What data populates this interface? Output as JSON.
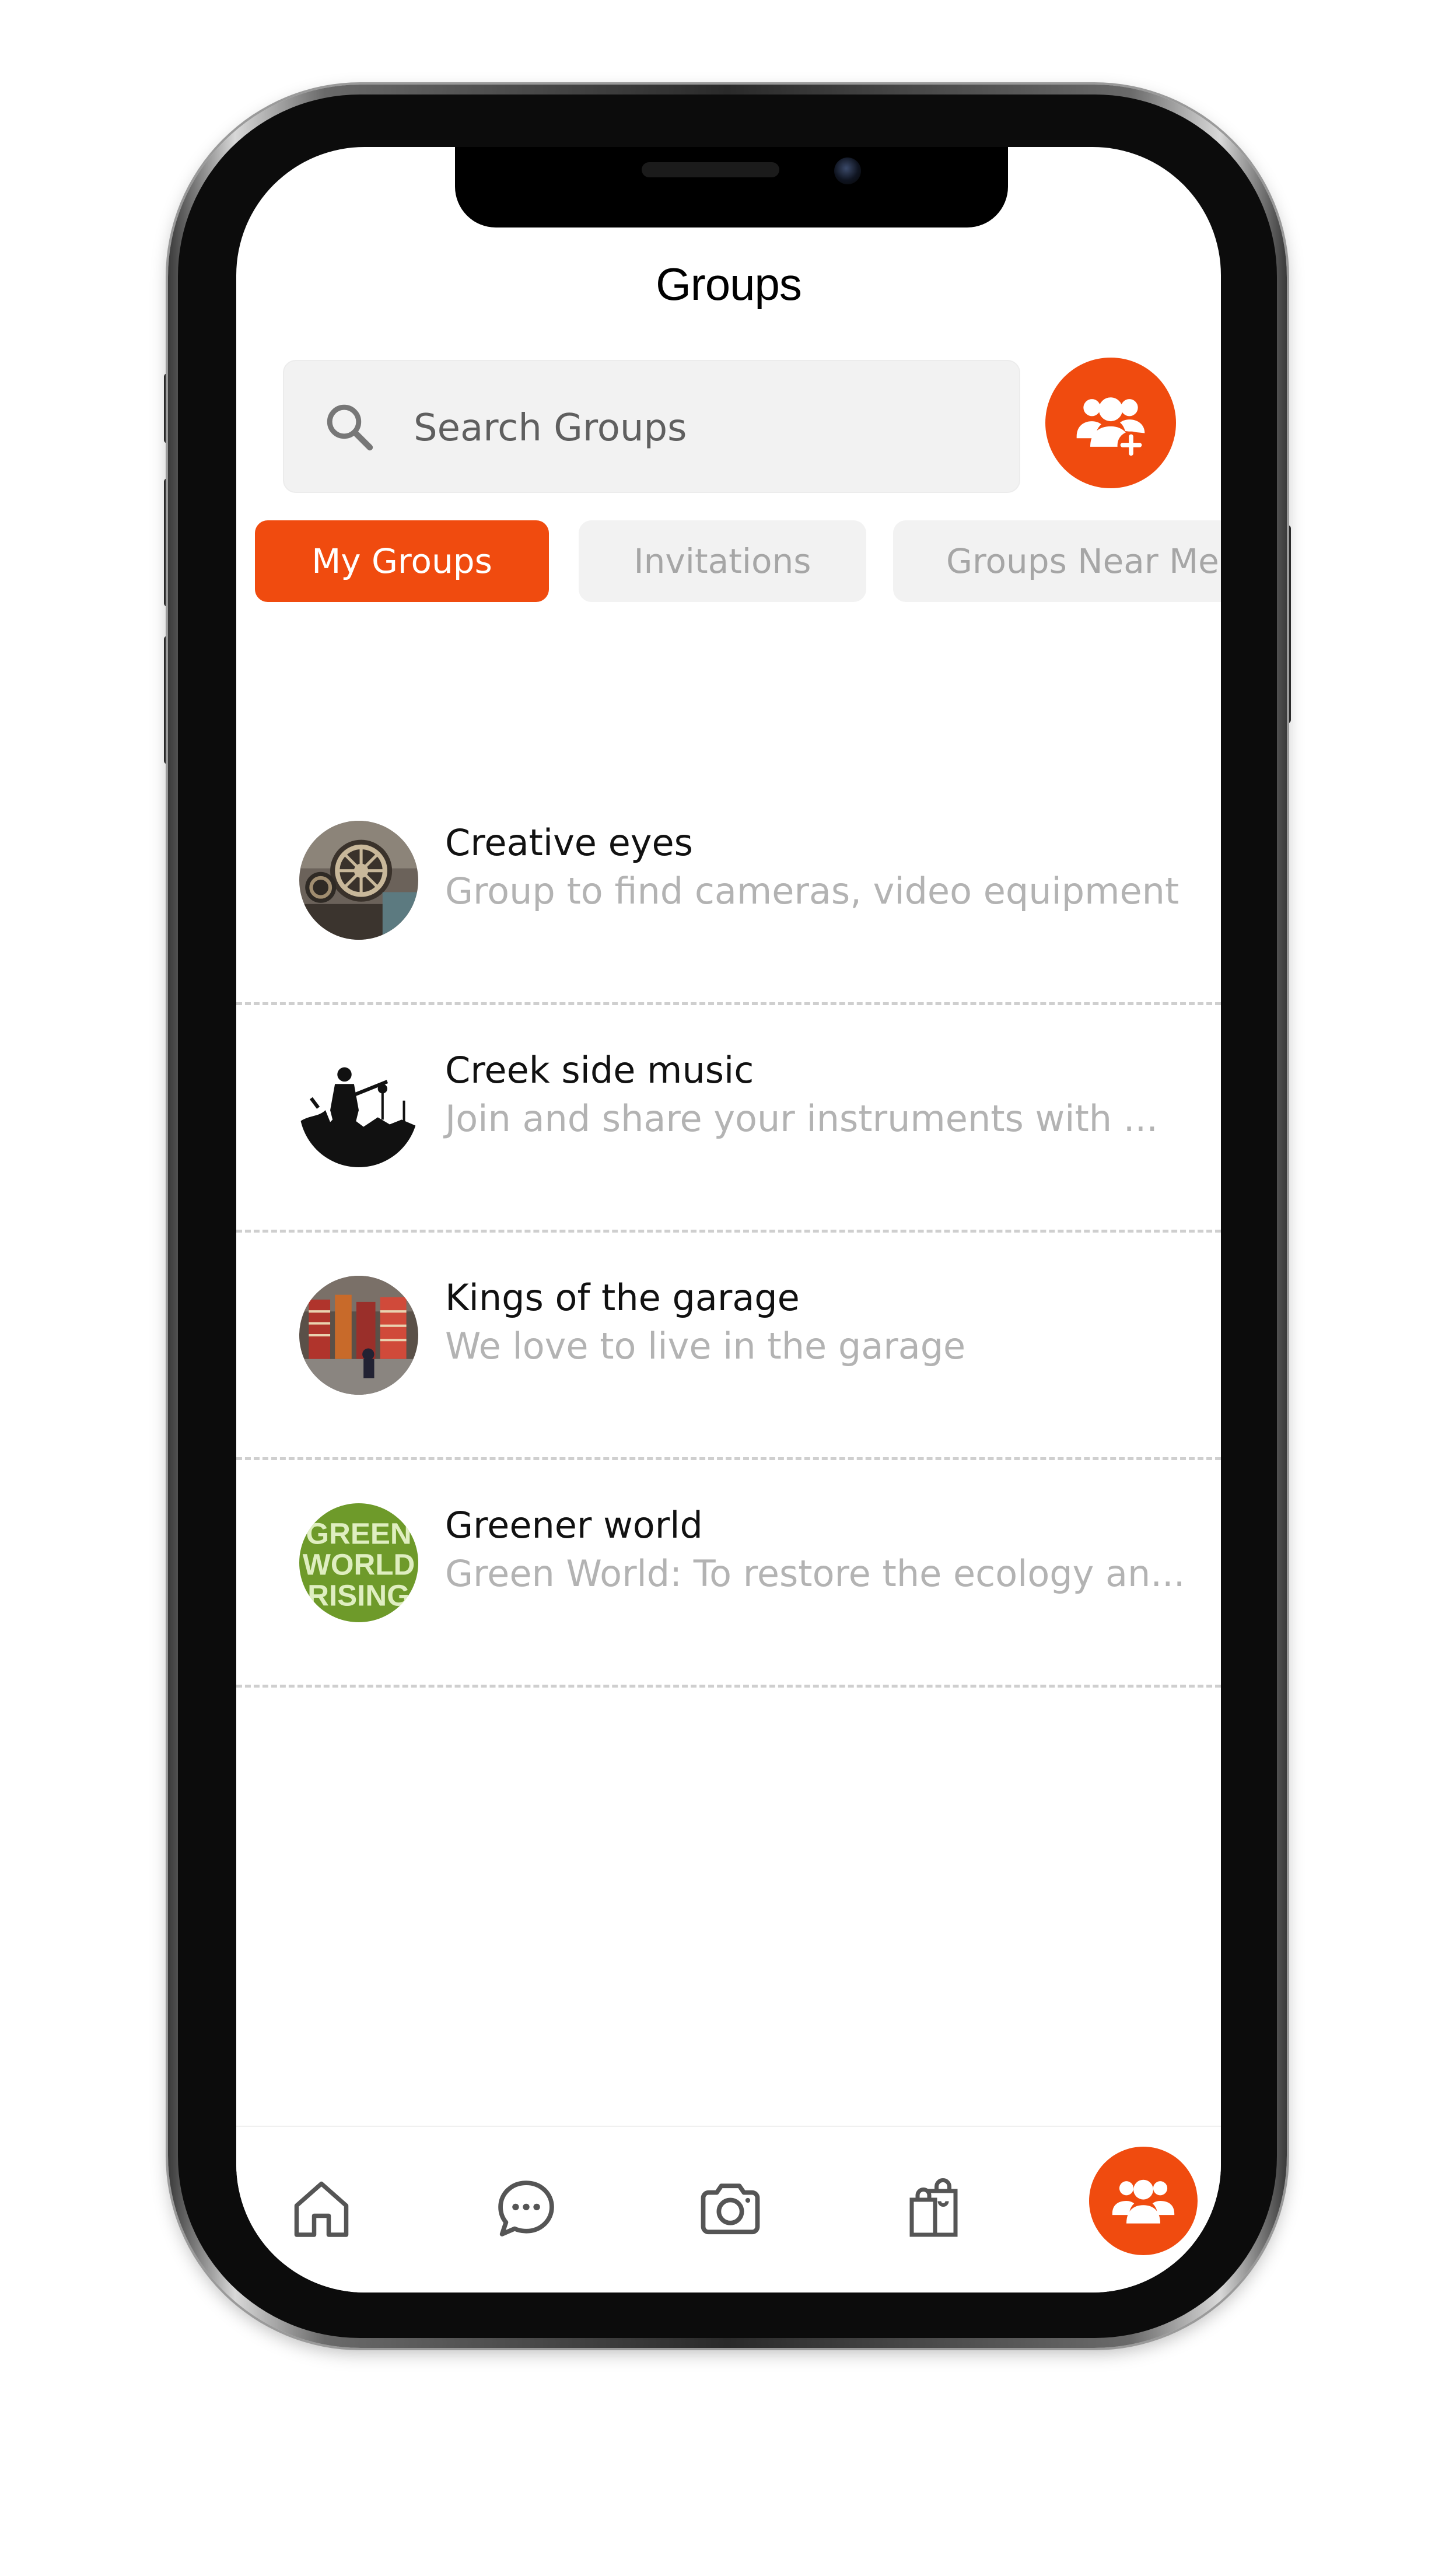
{
  "header": {
    "title": "Groups"
  },
  "search": {
    "placeholder": "Search Groups"
  },
  "tabs": [
    {
      "label": "My Groups",
      "active": true
    },
    {
      "label": "Invitations",
      "active": false
    },
    {
      "label": "Groups Near Me",
      "active": false
    }
  ],
  "groups": [
    {
      "name": "Creative eyes",
      "description": "Group to find cameras, video equipment",
      "avatar": "film-projector-photo"
    },
    {
      "name": "Creek side music",
      "description": "Join and share your instruments with ...",
      "avatar": "band-silhouette-photo"
    },
    {
      "name": "Kings of the garage",
      "description": "We love to live in the garage",
      "avatar": "garage-store-photo"
    },
    {
      "name": "Greener world",
      "description": "Green World: To restore the ecology an...",
      "avatar": "green-world-rising-logo",
      "avatar_text": "GREEN WORLD RISING"
    }
  ],
  "bottom_nav": [
    {
      "icon": "home-icon",
      "active": false
    },
    {
      "icon": "chat-icon",
      "active": false
    },
    {
      "icon": "camera-icon",
      "active": false
    },
    {
      "icon": "shopping-bags-icon",
      "active": false
    },
    {
      "icon": "groups-icon",
      "active": true
    }
  ],
  "colors": {
    "accent": "#f04b0f",
    "tab_inactive_bg": "#f2f2f2",
    "muted_text": "#b3b3b3"
  }
}
